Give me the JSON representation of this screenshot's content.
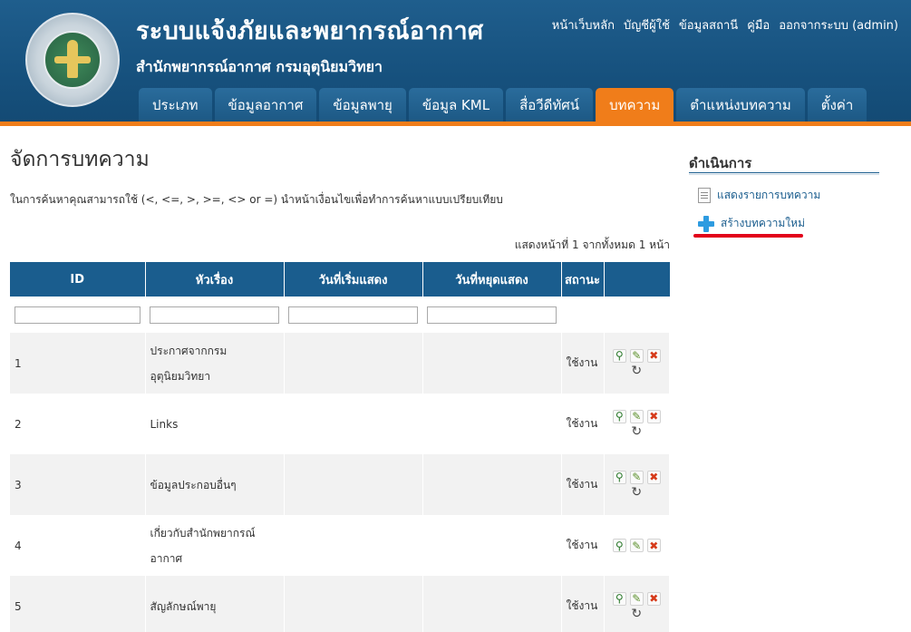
{
  "header": {
    "title": "ระบบแจ้งภัยและพยากรณ์อากาศ",
    "subtitle": "สำนักพยากรณ์อากาศ กรมอุตุนิยมวิทยา",
    "toplinks": [
      "หน้าเว็บหลัก",
      "บัญชีผู้ใช้",
      "ข้อมูลสถานี",
      "คู่มือ",
      "ออกจากระบบ (admin)"
    ]
  },
  "nav": {
    "tabs": [
      "ประเภท",
      "ข้อมูลอากาศ",
      "ข้อมูลพายุ",
      "ข้อมูล KML",
      "สื่อวีดีทัศน์",
      "บทความ",
      "ตำแหน่งบทความ",
      "ตั้งค่า"
    ],
    "active": "บทความ"
  },
  "main": {
    "page_title": "จัดการบทความ",
    "hint": "ในการค้นหาคุณสามารถใช้ (<, <=, >, >=, <> or =) นำหน้าเงื่อนไขเพื่อทำการค้นหาแบบเปรียบเทียบ",
    "pager": "แสดงหน้าที่ 1 จากทั้งหมด 1 หน้า"
  },
  "table": {
    "columns": [
      "ID",
      "หัวเรื่อง",
      "วันที่เริ่มแสดง",
      "วันที่หยุดแสดง",
      "สถานะ",
      ""
    ],
    "rows": [
      {
        "id": "1",
        "title_line1": "ประกาศจากกรม",
        "title_line2": "อุตุนิยมวิทยา",
        "start": "",
        "end": "",
        "status": "ใช้งาน"
      },
      {
        "id": "2",
        "title_line1": "Links",
        "title_line2": "",
        "start": "",
        "end": "",
        "status": "ใช้งาน"
      },
      {
        "id": "3",
        "title_line1": "ข้อมูลประกอบอื่นๆ",
        "title_line2": "",
        "start": "",
        "end": "",
        "status": "ใช้งาน"
      },
      {
        "id": "4",
        "title_line1": "เกี่ยวกับสำนักพยากรณ์",
        "title_line2": "อากาศ",
        "start": "",
        "end": "",
        "status": "ใช้งาน"
      },
      {
        "id": "5",
        "title_line1": "สัญลักษณ์พายุ",
        "title_line2": "",
        "start": "",
        "end": "",
        "status": "ใช้งาน"
      }
    ]
  },
  "sidebar": {
    "title": "ดำเนินการ",
    "list_label": "แสดงรายการบทความ",
    "create_label": "สร้างบทความใหม่"
  },
  "colors": {
    "header_blue": "#17527f",
    "accent_orange": "#f07d1a",
    "table_header": "#1a5d8e",
    "link": "#1a5d8e",
    "highlight_red": "#e2001a"
  }
}
